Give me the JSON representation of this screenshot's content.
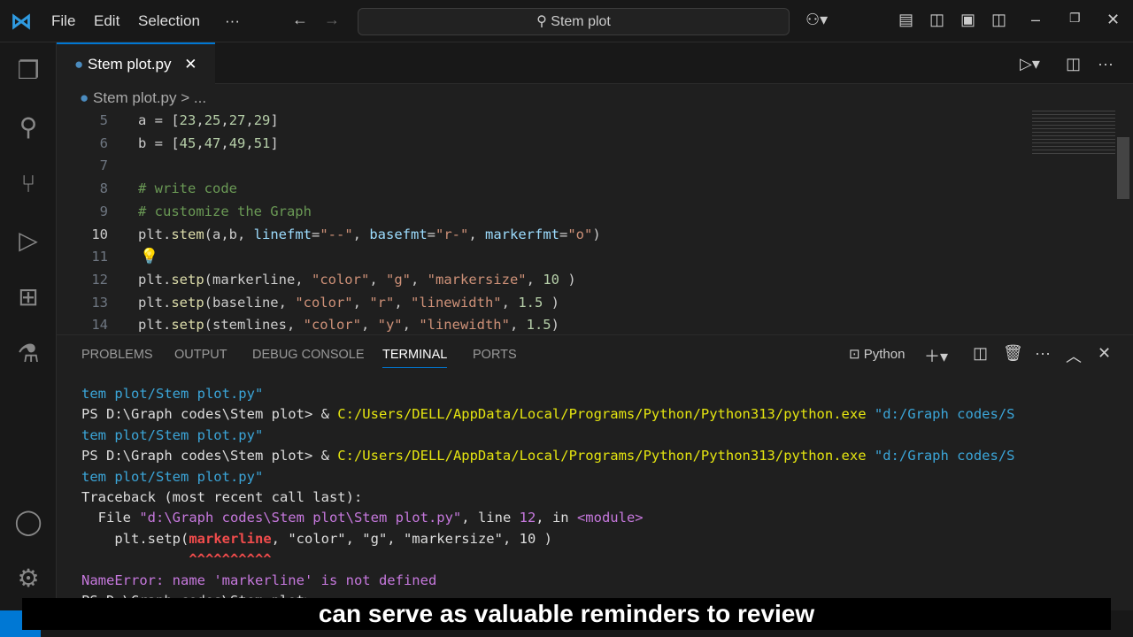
{
  "menu": {
    "file": "File",
    "edit": "Edit",
    "selection": "Selection",
    "more": "···"
  },
  "search": {
    "text": "Stem plot"
  },
  "tab": {
    "label": "Stem plot.py"
  },
  "breadcrumb": {
    "file": "Stem plot.py",
    "rest": "> ..."
  },
  "code": [
    {
      "num": "5",
      "tokens": [
        [
          "a = [",
          "k"
        ],
        [
          "23",
          "n"
        ],
        [
          ",",
          "k"
        ],
        [
          "25",
          "n"
        ],
        [
          ",",
          "k"
        ],
        [
          "27",
          "n"
        ],
        [
          ",",
          "k"
        ],
        [
          "29",
          "n"
        ],
        [
          "]",
          "k"
        ]
      ]
    },
    {
      "num": "6",
      "tokens": [
        [
          "b = [",
          "k"
        ],
        [
          "45",
          "n"
        ],
        [
          ",",
          "k"
        ],
        [
          "47",
          "n"
        ],
        [
          ",",
          "k"
        ],
        [
          "49",
          "n"
        ],
        [
          ",",
          "k"
        ],
        [
          "51",
          "n"
        ],
        [
          "]",
          "k"
        ]
      ]
    },
    {
      "num": "7",
      "tokens": []
    },
    {
      "num": "8",
      "tokens": [
        [
          "# write code",
          "c"
        ]
      ]
    },
    {
      "num": "9",
      "tokens": [
        [
          "# customize the Graph",
          "c"
        ]
      ]
    },
    {
      "num": "10",
      "tokens": [
        [
          "plt.",
          "k"
        ],
        [
          "stem",
          "b"
        ],
        [
          "(a,b, ",
          "k"
        ],
        [
          "linefmt",
          "p"
        ],
        [
          "=",
          "k"
        ],
        [
          "\"--\"",
          "s"
        ],
        [
          ", ",
          "k"
        ],
        [
          "basefmt",
          "p"
        ],
        [
          "=",
          "k"
        ],
        [
          "\"r-\"",
          "s"
        ],
        [
          ", ",
          "k"
        ],
        [
          "markerfmt",
          "p"
        ],
        [
          "=",
          "k"
        ],
        [
          "\"o\"",
          "s"
        ],
        [
          ")",
          "k"
        ]
      ]
    },
    {
      "num": "11",
      "tokens": []
    },
    {
      "num": "12",
      "tokens": [
        [
          "plt.",
          "k"
        ],
        [
          "setp",
          "b"
        ],
        [
          "(markerline, ",
          "k"
        ],
        [
          "\"color\"",
          "s"
        ],
        [
          ", ",
          "k"
        ],
        [
          "\"g\"",
          "s"
        ],
        [
          ", ",
          "k"
        ],
        [
          "\"markersize\"",
          "s"
        ],
        [
          ", ",
          "k"
        ],
        [
          "10",
          "n"
        ],
        [
          " )",
          "k"
        ]
      ]
    },
    {
      "num": "13",
      "tokens": [
        [
          "plt.",
          "k"
        ],
        [
          "setp",
          "b"
        ],
        [
          "(baseline, ",
          "k"
        ],
        [
          "\"color\"",
          "s"
        ],
        [
          ", ",
          "k"
        ],
        [
          "\"r\"",
          "s"
        ],
        [
          ", ",
          "k"
        ],
        [
          "\"linewidth\"",
          "s"
        ],
        [
          ", ",
          "k"
        ],
        [
          "1.5",
          "n"
        ],
        [
          " )",
          "k"
        ]
      ]
    },
    {
      "num": "14",
      "tokens": [
        [
          "plt.",
          "k"
        ],
        [
          "setp",
          "b"
        ],
        [
          "(stemlines, ",
          "k"
        ],
        [
          "\"color\"",
          "s"
        ],
        [
          ", ",
          "k"
        ],
        [
          "\"y\"",
          "s"
        ],
        [
          ", ",
          "k"
        ],
        [
          "\"linewidth\"",
          "s"
        ],
        [
          ", ",
          "k"
        ],
        [
          "1.5",
          "n"
        ],
        [
          ")",
          "k"
        ]
      ]
    }
  ],
  "panel": {
    "tabs": [
      "PROBLEMS",
      "OUTPUT",
      "DEBUG CONSOLE",
      "TERMINAL",
      "PORTS"
    ],
    "shell": "Python"
  },
  "terminal": [
    [
      [
        "tem plot/Stem plot.py\"",
        "cy"
      ]
    ],
    [
      [
        "PS D:\\Graph codes\\Stem plot> & ",
        "w"
      ],
      [
        "C:/Users/DELL/AppData/Local/Programs/Python/Python313/python.exe",
        "y"
      ],
      [
        " \"d:/Graph codes/S",
        "cy"
      ]
    ],
    [
      [
        "tem plot/Stem plot.py\"",
        "cy"
      ]
    ],
    [
      [
        "PS D:\\Graph codes\\Stem plot> & ",
        "w"
      ],
      [
        "C:/Users/DELL/AppData/Local/Programs/Python/Python313/python.exe",
        "y"
      ],
      [
        " \"d:/Graph codes/S",
        "cy"
      ]
    ],
    [
      [
        "tem plot/Stem plot.py\"",
        "cy"
      ]
    ],
    [
      [
        "Traceback (most recent call last):",
        "w"
      ]
    ],
    [
      [
        "  File ",
        "w"
      ],
      [
        "\"d:\\Graph codes\\Stem plot\\Stem plot.py\"",
        "m"
      ],
      [
        ", line ",
        "w"
      ],
      [
        "12",
        "m"
      ],
      [
        ", in ",
        "w"
      ],
      [
        "<module>",
        "m"
      ]
    ],
    [
      [
        "    plt.setp(",
        "w"
      ],
      [
        "markerline",
        "r"
      ],
      [
        ", \"color\", \"g\", \"markersize\", 10 )",
        "w"
      ]
    ],
    [
      [
        "             ^^^^^^^^^^",
        "r"
      ]
    ],
    [
      [
        "NameError",
        "m"
      ],
      [
        ": name 'markerline' is not defined",
        "m"
      ]
    ],
    [
      [
        "PS D:\\Graph codes\\Stem plot> ",
        "w"
      ]
    ]
  ],
  "caption": "can serve as valuable reminders to review"
}
